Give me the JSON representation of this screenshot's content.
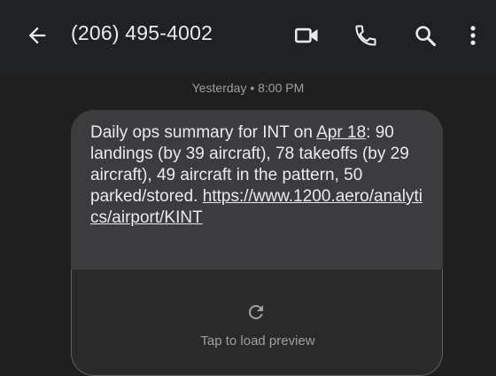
{
  "header": {
    "title": "(206) 495-4002"
  },
  "conversation": {
    "timestamp": "Yesterday • 8:00 PM",
    "message": {
      "text_before_link1": "Daily ops summary for INT on ",
      "link1": "Apr 18",
      "text_after_link1": ": 90 landings (by 39 aircraft), 78 takeoffs (by 29 aircraft), 49 aircraft in the pattern, 50 parked/stored. ",
      "link2": "https://www.1200.aero/analytics/airport/KINT"
    },
    "preview": {
      "label": "Tap to load preview"
    }
  }
}
